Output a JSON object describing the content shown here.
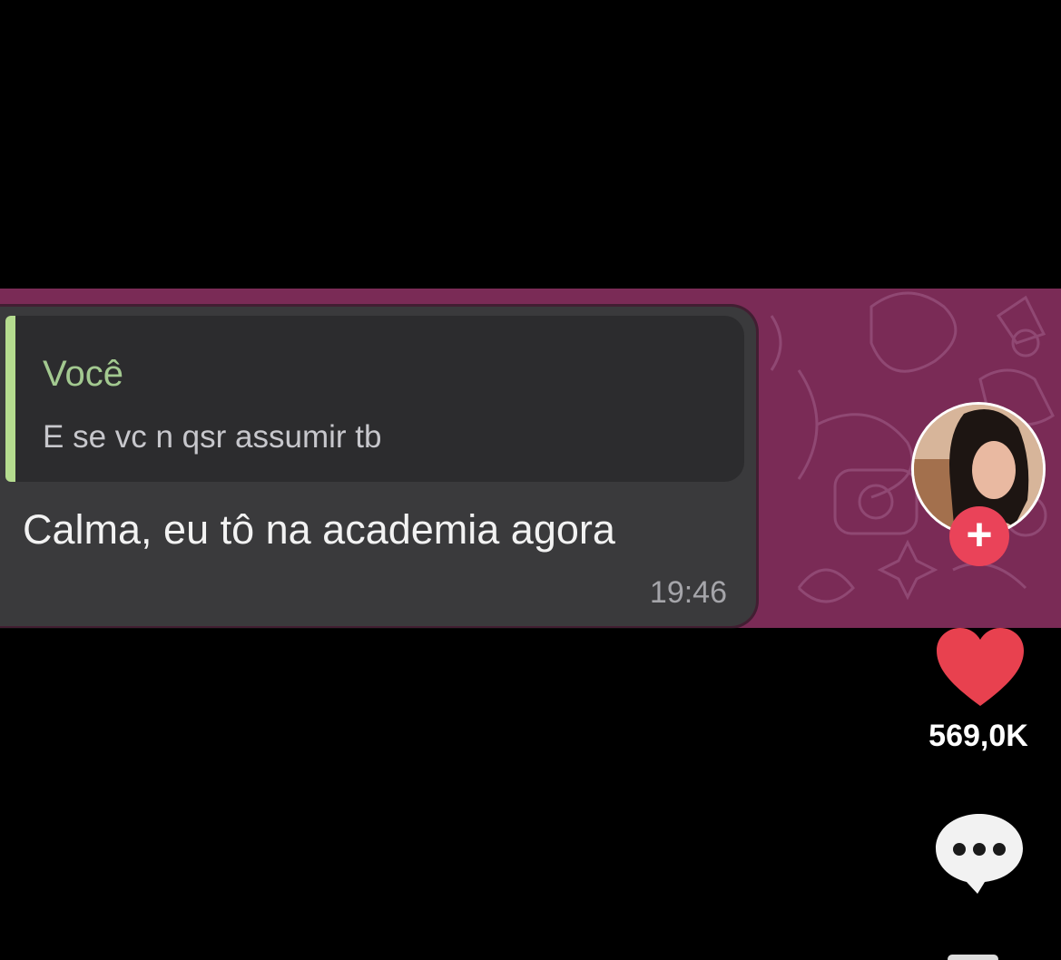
{
  "chat": {
    "quote": {
      "author": "Você",
      "text": "E se vc n qsr assumir tb"
    },
    "message": {
      "text": "Calma, eu tô na academia agora",
      "time": "19:46"
    },
    "colors": {
      "wallpaper": "#7a2b56",
      "bubble": "#3a3a3c",
      "quote_bar": "#b5dc8f",
      "quote_author": "#a3c990"
    }
  },
  "sidebar": {
    "follow_label": "+",
    "like_count": "569,0K",
    "icons": [
      "avatar",
      "follow-plus-icon",
      "heart-icon",
      "comment-icon"
    ],
    "colors": {
      "like": "#e8414f",
      "follow": "#ea4359"
    }
  }
}
